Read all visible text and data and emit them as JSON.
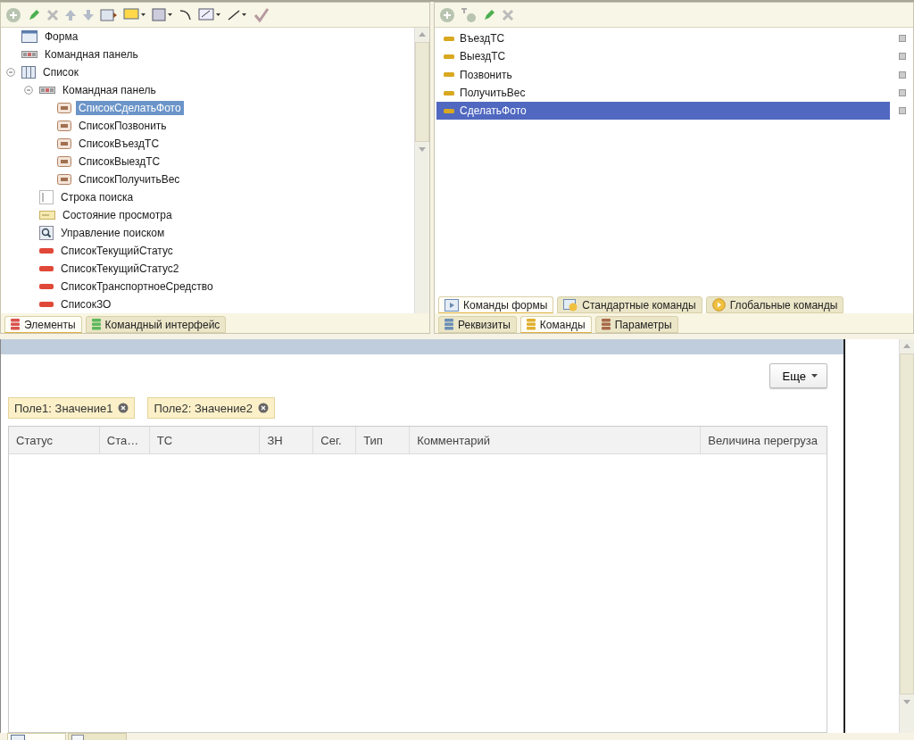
{
  "left_panel": {
    "tree": [
      {
        "label": "Форма",
        "kind": "form",
        "selected": false
      },
      {
        "label": "Командная панель",
        "kind": "command-bar",
        "selected": false
      },
      {
        "label": "Список",
        "kind": "table",
        "selected": false,
        "expanded": true,
        "children": [
          {
            "label": "Командная панель",
            "kind": "command-bar",
            "selected": false,
            "expanded": true,
            "children": [
              {
                "label": "СписокСделатьФото",
                "kind": "button",
                "selected": true
              },
              {
                "label": "СписокПозвонить",
                "kind": "button",
                "selected": false
              },
              {
                "label": "СписокВъездТС",
                "kind": "button",
                "selected": false
              },
              {
                "label": "СписокВыездТС",
                "kind": "button",
                "selected": false
              },
              {
                "label": "СписокПолучитьВес",
                "kind": "button",
                "selected": false
              }
            ]
          },
          {
            "label": "Строка поиска",
            "kind": "search-string",
            "selected": false
          },
          {
            "label": "Состояние просмотра",
            "kind": "view-status",
            "selected": false
          },
          {
            "label": "Управление поиском",
            "kind": "search-control",
            "selected": false
          },
          {
            "label": "СписокТекущийСтатус",
            "kind": "field",
            "selected": false
          },
          {
            "label": "СписокТекущийСтатус2",
            "kind": "field",
            "selected": false
          },
          {
            "label": "СписокТранспортноеСредство",
            "kind": "field",
            "selected": false
          },
          {
            "label": "СписокЗО",
            "kind": "field",
            "selected": false
          }
        ]
      }
    ],
    "tabs": [
      {
        "label": "Элементы",
        "color": "#d9534f",
        "selected": true
      },
      {
        "label": "Командный интерфейс",
        "color": "#5cb85c",
        "selected": false
      }
    ]
  },
  "right_panel": {
    "commands": [
      {
        "label": "ВъездТС",
        "selected": false
      },
      {
        "label": "ВыездТС",
        "selected": false
      },
      {
        "label": "Позвонить",
        "selected": false
      },
      {
        "label": "ПолучитьВес",
        "selected": false
      },
      {
        "label": "СделатьФото",
        "selected": true
      }
    ],
    "command_tabs": [
      {
        "label": "Команды формы",
        "selected": true
      },
      {
        "label": "Стандартные команды",
        "selected": false
      },
      {
        "label": "Глобальные команды",
        "selected": false
      }
    ],
    "tabs": [
      {
        "label": "Реквизиты",
        "color": "#6c8fb5",
        "selected": false
      },
      {
        "label": "Команды",
        "color": "#e0b030",
        "selected": true
      },
      {
        "label": "Параметры",
        "color": "#a86a4a",
        "selected": false
      }
    ]
  },
  "form_preview": {
    "more_button": "Еще",
    "filters": [
      {
        "label": "Поле1: Значение1"
      },
      {
        "label": "Поле2: Значение2"
      }
    ],
    "table": {
      "columns": [
        "Статус",
        "Ста…",
        "ТС",
        "ЗН",
        "Сег.",
        "Тип",
        "Комментарий",
        "Величина перегруза"
      ]
    }
  }
}
